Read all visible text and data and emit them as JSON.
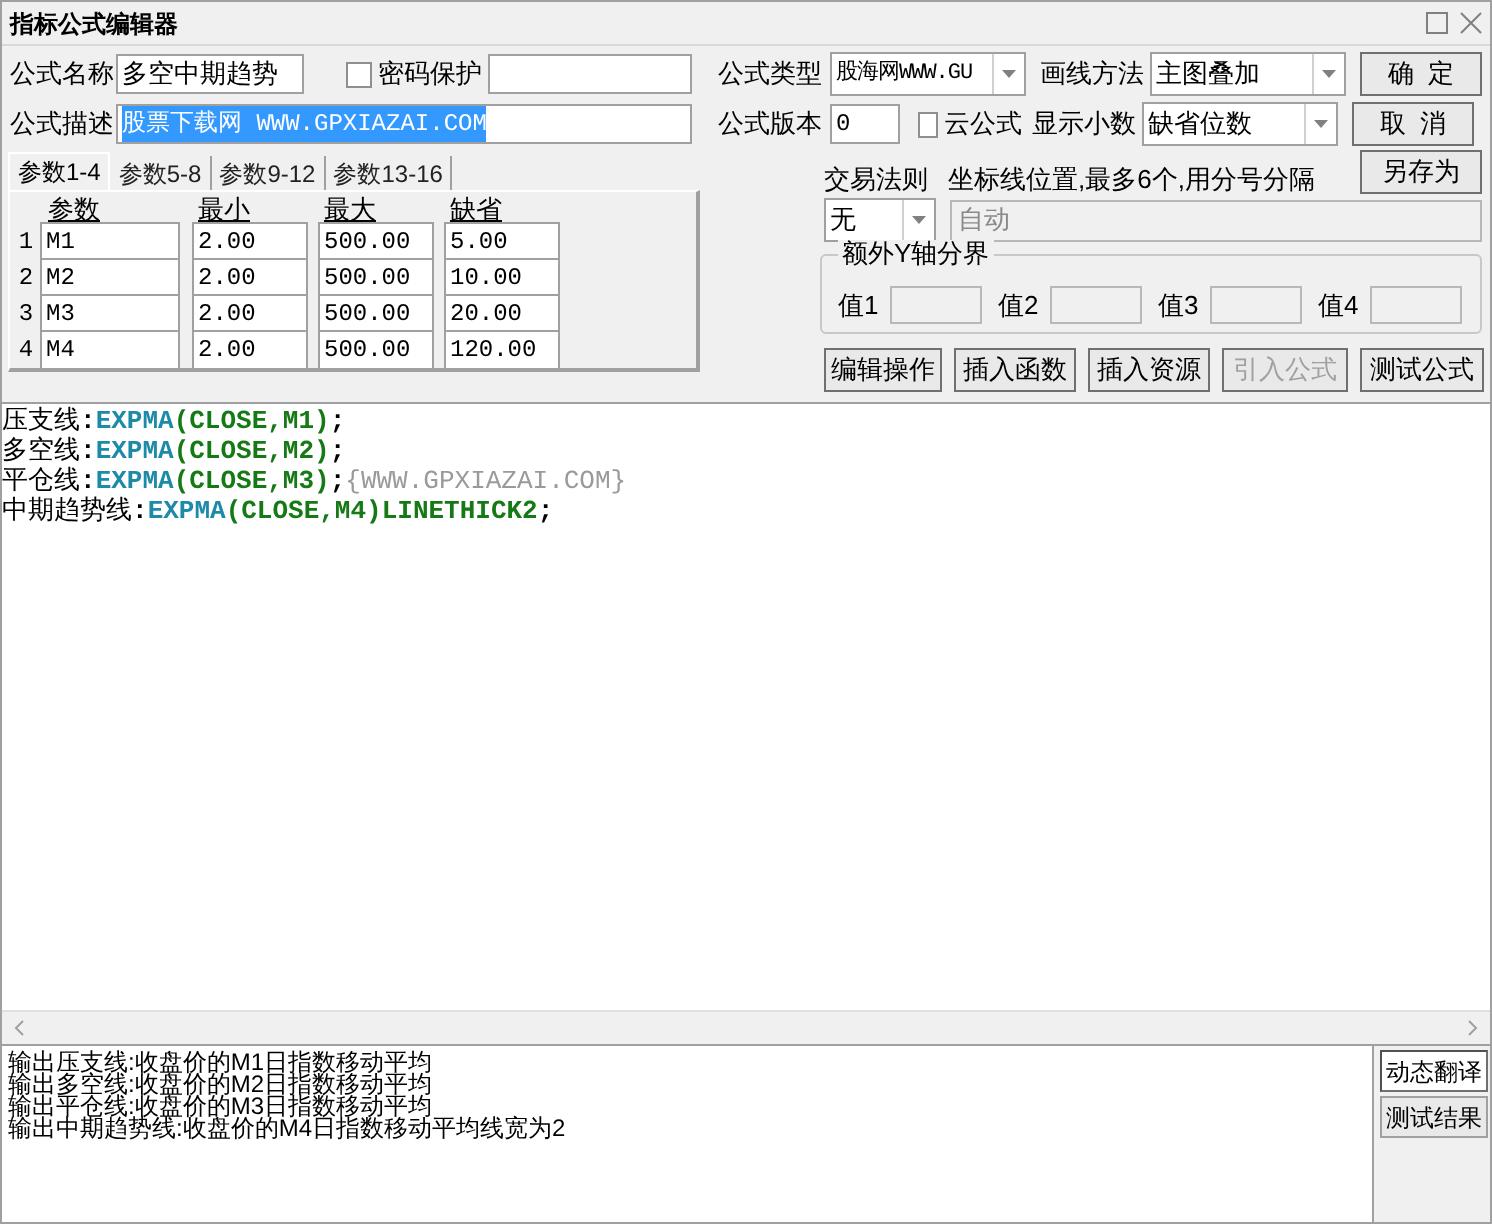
{
  "window": {
    "title": "指标公式编辑器"
  },
  "form": {
    "name_label": "公式名称",
    "name_value": "多空中期趋势",
    "password": {
      "label": "密码保护",
      "checked": false
    },
    "type_label": "公式类型",
    "type_value": "股海网WWW.GU",
    "draw_label": "画线方法",
    "draw_value": "主图叠加",
    "desc_label": "公式描述",
    "desc": {
      "value": "股票下载网 WWW.GPXIAZAI.COM",
      "selected": true
    },
    "version_label": "公式版本",
    "version_value": "0",
    "cloud": {
      "label": "云公式",
      "checked": false
    },
    "decimals_label": "显示小数",
    "decimals_value": "缺省位数"
  },
  "side_buttons": [
    {
      "label": "确  定"
    },
    {
      "label": "取  消"
    },
    {
      "label": "另存为"
    }
  ],
  "tabs": [
    {
      "label": "参数1-4",
      "selected": true
    },
    {
      "label": "参数5-8",
      "selected": false
    },
    {
      "label": "参数9-12",
      "selected": false
    },
    {
      "label": "参数13-16",
      "selected": false
    }
  ],
  "params": {
    "columns": [
      "参数",
      "最小",
      "最大",
      "缺省"
    ],
    "rows": [
      {
        "index": "1",
        "name": "M1",
        "min": "2.00",
        "max": "500.00",
        "default": "5.00"
      },
      {
        "index": "2",
        "name": "M2",
        "min": "2.00",
        "max": "500.00",
        "default": "10.00"
      },
      {
        "index": "3",
        "name": "M3",
        "min": "2.00",
        "max": "500.00",
        "default": "20.00"
      },
      {
        "index": "4",
        "name": "M4",
        "min": "2.00",
        "max": "500.00",
        "default": "120.00"
      }
    ]
  },
  "trade_rule": {
    "label": "交易法则",
    "value": "无"
  },
  "axis": {
    "label": "坐标线位置,最多6个,用分号分隔",
    "value": "自动",
    "disabled": true
  },
  "extra_y": {
    "title": "额外Y轴分界",
    "fields": [
      {
        "label": "值1"
      },
      {
        "label": "值2"
      },
      {
        "label": "值3"
      },
      {
        "label": "值4"
      }
    ]
  },
  "action_buttons": [
    {
      "label": "编辑操作",
      "disabled": false
    },
    {
      "label": "插入函数",
      "disabled": false
    },
    {
      "label": "插入资源",
      "disabled": false
    },
    {
      "label": "引入公式",
      "disabled": true
    },
    {
      "label": "测试公式",
      "disabled": false
    }
  ],
  "code": {
    "lines": [
      [
        {
          "kind": "name",
          "text": "压支线"
        },
        {
          "kind": "sep",
          "text": ":"
        },
        {
          "kind": "func",
          "text": "EXPMA"
        },
        {
          "kind": "arg",
          "text": "(CLOSE,M1)"
        },
        {
          "kind": "sep",
          "text": ";"
        }
      ],
      [
        {
          "kind": "name",
          "text": "多空线"
        },
        {
          "kind": "sep",
          "text": ":"
        },
        {
          "kind": "func",
          "text": "EXPMA"
        },
        {
          "kind": "arg",
          "text": "(CLOSE,M2)"
        },
        {
          "kind": "sep",
          "text": ";"
        }
      ],
      [
        {
          "kind": "name",
          "text": "平仓线"
        },
        {
          "kind": "sep",
          "text": ":"
        },
        {
          "kind": "func",
          "text": "EXPMA"
        },
        {
          "kind": "arg",
          "text": "(CLOSE,M3)"
        },
        {
          "kind": "sep",
          "text": ";"
        },
        {
          "kind": "comment",
          "text": "{WWW.GPXIAZAI.COM}"
        }
      ],
      [
        {
          "kind": "name",
          "text": "中期趋势线"
        },
        {
          "kind": "sep",
          "text": ":"
        },
        {
          "kind": "func",
          "text": "EXPMA"
        },
        {
          "kind": "arg",
          "text": "(CLOSE,M4)LINETHICK2"
        },
        {
          "kind": "sep",
          "text": ";"
        }
      ]
    ]
  },
  "output": {
    "lines": [
      "输出压支线:收盘价的M1日指数移动平均",
      "输出多空线:收盘价的M2日指数移动平均",
      "输出平仓线:收盘价的M3日指数移动平均",
      "输出中期趋势线:收盘价的M4日指数移动平均线宽为2"
    ]
  },
  "output_tabs": [
    {
      "label": "动态翻译",
      "selected": true
    },
    {
      "label": "测试结果",
      "selected": false
    }
  ]
}
